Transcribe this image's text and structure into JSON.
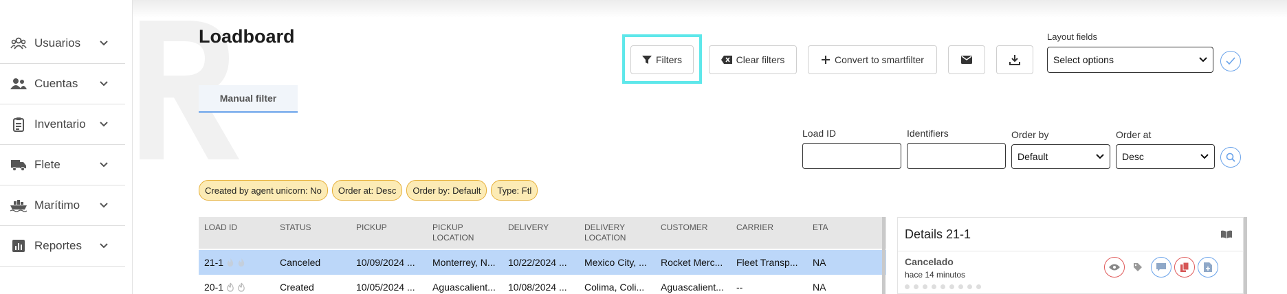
{
  "sidebar": {
    "items": [
      {
        "label": "Usuarios",
        "icon": "users-icon"
      },
      {
        "label": "Cuentas",
        "icon": "accounts-icon"
      },
      {
        "label": "Inventario",
        "icon": "clipboard-icon"
      },
      {
        "label": "Flete",
        "icon": "truck-icon"
      },
      {
        "label": "Marítimo",
        "icon": "ship-icon"
      },
      {
        "label": "Reportes",
        "icon": "report-chart-icon"
      }
    ]
  },
  "header": {
    "title": "Loadboard",
    "filters_label": "Filters",
    "clear_filters_label": "Clear filters",
    "convert_label": "Convert to smartfilter",
    "layout_fields_label": "Layout fields",
    "layout_select_value": "Select options"
  },
  "tabs": {
    "manual_filter": "Manual filter"
  },
  "search_fields": {
    "load_id_label": "Load ID",
    "identifiers_label": "Identifiers",
    "order_by_label": "Order by",
    "order_by_value": "Default",
    "order_at_label": "Order at",
    "order_at_value": "Desc"
  },
  "chips": [
    "Created by agent unicorn: No",
    "Order at: Desc",
    "Order by: Default",
    "Type: Ftl"
  ],
  "table": {
    "headers": {
      "load_id": "LOAD ID",
      "status": "STATUS",
      "pickup": "PICKUP",
      "pickup_location_1": "PICKUP",
      "pickup_location_2": "LOCATION",
      "delivery": "DELIVERY",
      "delivery_location_1": "DELIVERY",
      "delivery_location_2": "LOCATION",
      "customer": "CUSTOMER",
      "carrier": "CARRIER",
      "eta": "ETA"
    },
    "rows": [
      {
        "load_id": "21-1",
        "status": "Canceled",
        "pickup": "10/09/2024 ...",
        "pickup_location": "Monterrey, N...",
        "delivery": "10/22/2024 ...",
        "delivery_location": "Mexico City, ...",
        "customer": "Rocket Merc...",
        "carrier": "Fleet Transp...",
        "eta": "NA"
      },
      {
        "load_id": "20-1",
        "status": "Created",
        "pickup": "10/05/2024 ...",
        "pickup_location": "Aguascalient...",
        "delivery": "10/08/2024 ...",
        "delivery_location": "Colima, Coli...",
        "customer": "Aguascalient...",
        "carrier": "--",
        "eta": "NA"
      }
    ]
  },
  "details": {
    "title": "Details 21-1",
    "status": "Cancelado",
    "time": "hace 14 minutos"
  },
  "colors": {
    "accent": "#6aa3ea",
    "focus_ring": "#5ee7ea",
    "selected_row": "#bcd7f9",
    "chip_bg": "#fcebb5",
    "chip_border": "#e6b03a",
    "danger": "#e05b5b"
  }
}
